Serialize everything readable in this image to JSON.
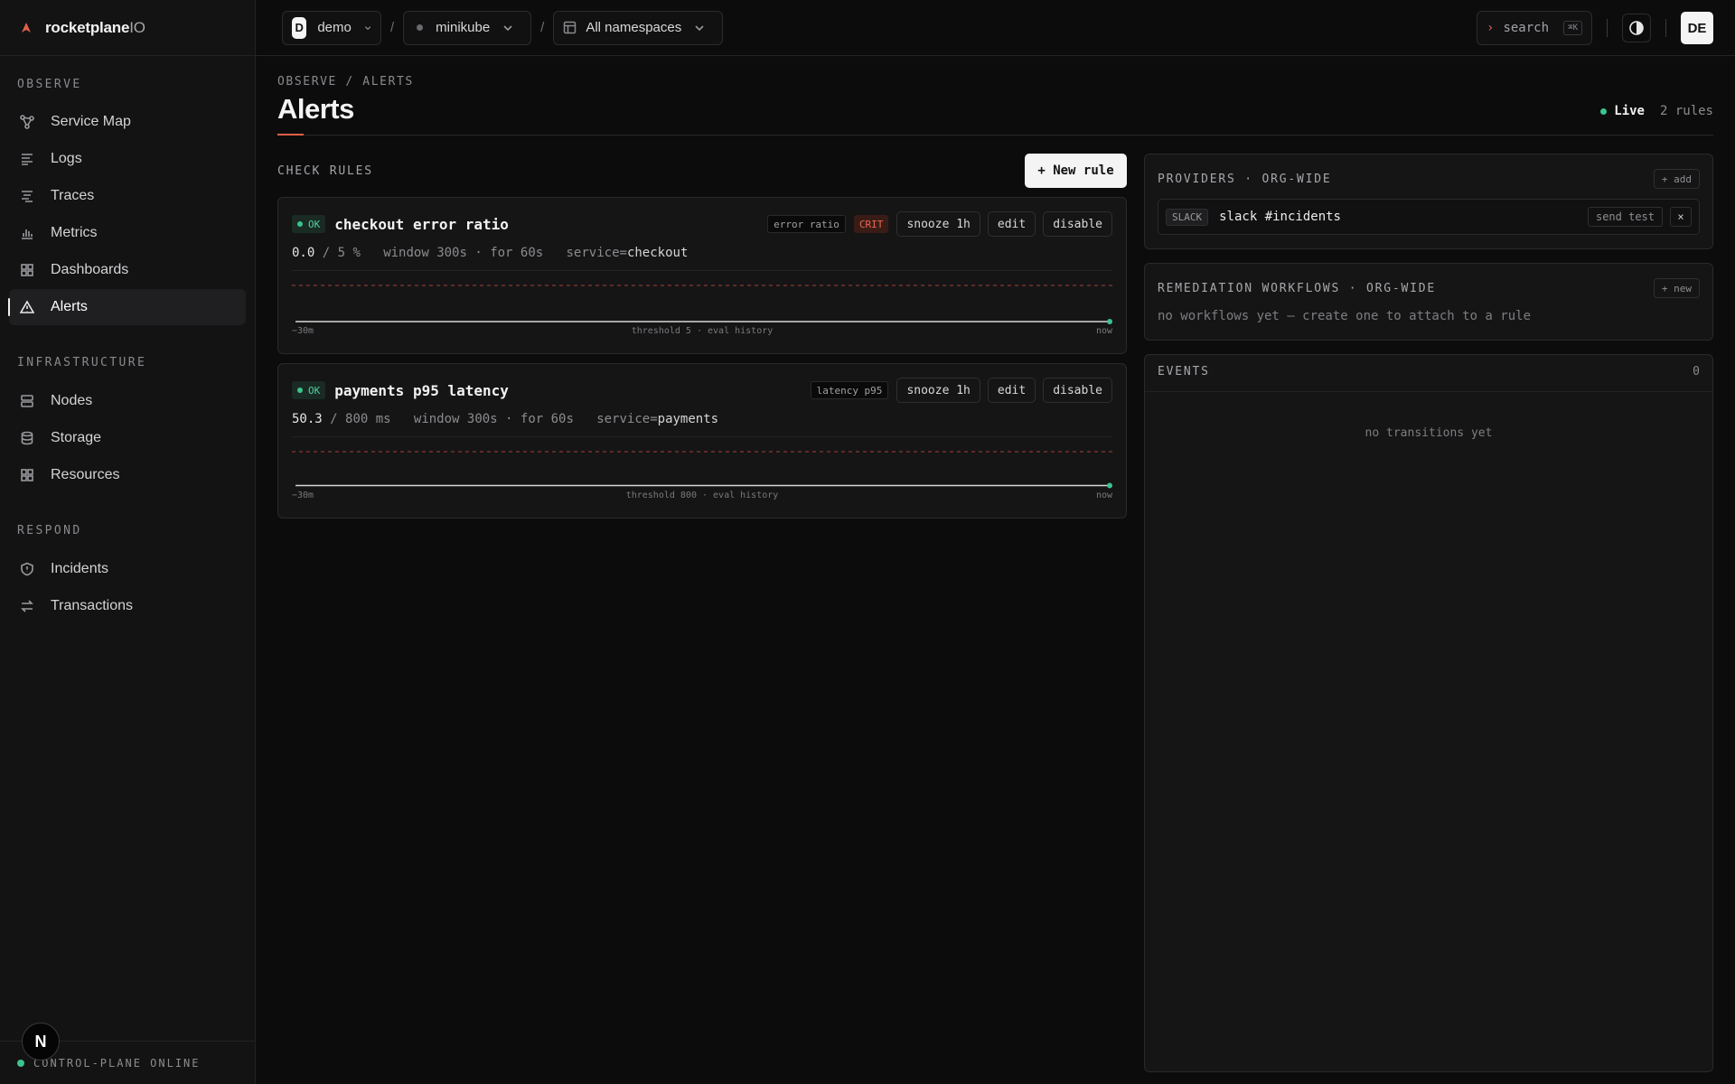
{
  "brand": {
    "name": "rocketplane",
    "suffix": "IO"
  },
  "sidebar": {
    "sections": [
      {
        "heading": "OBSERVE",
        "items": [
          {
            "label": "Service Map",
            "icon": "service-map-icon"
          },
          {
            "label": "Logs",
            "icon": "logs-icon"
          },
          {
            "label": "Traces",
            "icon": "traces-icon"
          },
          {
            "label": "Metrics",
            "icon": "metrics-icon"
          },
          {
            "label": "Dashboards",
            "icon": "dashboards-icon"
          },
          {
            "label": "Alerts",
            "icon": "alert-triangle-icon",
            "active": true
          }
        ]
      },
      {
        "heading": "INFRASTRUCTURE",
        "items": [
          {
            "label": "Nodes",
            "icon": "server-icon"
          },
          {
            "label": "Storage",
            "icon": "database-icon"
          },
          {
            "label": "Resources",
            "icon": "grid-icon"
          }
        ]
      },
      {
        "heading": "RESPOND",
        "items": [
          {
            "label": "Incidents",
            "icon": "shield-icon"
          },
          {
            "label": "Transactions",
            "icon": "swap-icon"
          }
        ]
      }
    ],
    "footer_status": "CONTROL-PLANE ONLINE",
    "badge_letter": "N"
  },
  "topbar": {
    "org": {
      "avatar": "D",
      "name": "demo"
    },
    "separator": "/",
    "cluster": "minikube",
    "namespace": "All namespaces",
    "search": {
      "chevron": "›",
      "label": "search",
      "shortcut": "⌘K"
    },
    "user_initials": "DE"
  },
  "page": {
    "breadcrumb": "OBSERVE / ALERTS",
    "title": "Alerts",
    "live_label": "Live",
    "rules_count": "2 rules"
  },
  "check_rules": {
    "heading": "CHECK RULES",
    "new_rule_label": "+ New rule",
    "rules": [
      {
        "status": "OK",
        "name": "checkout error ratio",
        "tag": "error ratio",
        "severity": "CRIT",
        "actions": {
          "snooze": "snooze 1h",
          "edit": "edit",
          "disable": "disable"
        },
        "value": "0.0",
        "threshold_text": "/ 5 %",
        "window": "window 300s · for 60s",
        "service_key": "service=",
        "service_value": "checkout",
        "axis": {
          "start": "−30m",
          "center": "threshold 5 · eval history",
          "end": "now"
        },
        "chart_data": {
          "type": "line",
          "threshold": 5,
          "values": [
            0,
            0,
            0,
            0,
            0,
            0,
            0,
            0,
            0,
            0
          ]
        }
      },
      {
        "status": "OK",
        "name": "payments p95 latency",
        "tag": "latency p95",
        "severity": "",
        "actions": {
          "snooze": "snooze 1h",
          "edit": "edit",
          "disable": "disable"
        },
        "value": "50.3",
        "threshold_text": "/ 800 ms",
        "window": "window 300s · for 60s",
        "service_key": "service=",
        "service_value": "payments",
        "axis": {
          "start": "−30m",
          "center": "threshold 800 · eval history",
          "end": "now"
        },
        "chart_data": {
          "type": "line",
          "threshold": 800,
          "values": [
            50.3,
            50.3,
            50.3,
            50.3,
            50.3,
            50.3,
            50.3,
            50.3,
            50.3,
            50.3
          ]
        }
      }
    ]
  },
  "providers": {
    "title": "PROVIDERS · ORG-WIDE",
    "add_label": "+ add",
    "items": [
      {
        "type": "SLACK",
        "name": "slack #incidents",
        "send_test": "send test",
        "remove": "×"
      }
    ]
  },
  "remediation": {
    "title": "REMEDIATION WORKFLOWS · ORG-WIDE",
    "new_label": "+ new",
    "empty": "no workflows yet — create one to attach to a rule"
  },
  "events": {
    "title": "EVENTS",
    "count": "0",
    "empty": "no transitions yet"
  },
  "colors": {
    "accent": "#e0604a",
    "ok": "#3cc48e",
    "crit": "#e86a54",
    "background": "#0c0c0d"
  }
}
